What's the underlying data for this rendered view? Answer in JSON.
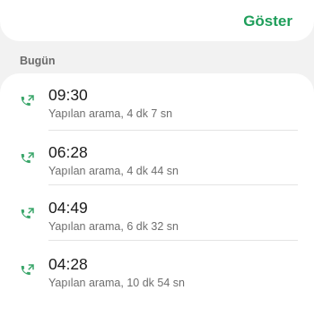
{
  "top_card": {
    "show_label": "Göster"
  },
  "section": {
    "title": "Bugün"
  },
  "calls": [
    {
      "time": "09:30",
      "detail": "Yapılan arama, 4 dk 7 sn",
      "icon": "outgoing-call-icon"
    },
    {
      "time": "06:28",
      "detail": "Yapılan arama, 4 dk 44 sn",
      "icon": "outgoing-call-icon"
    },
    {
      "time": "04:49",
      "detail": "Yapılan arama, 6 dk 32 sn",
      "icon": "outgoing-call-icon"
    },
    {
      "time": "04:28",
      "detail": "Yapılan arama, 10 dk 54 sn",
      "icon": "outgoing-call-icon"
    }
  ],
  "colors": {
    "accent": "#1e9e5a",
    "icon": "#3aa66a"
  }
}
